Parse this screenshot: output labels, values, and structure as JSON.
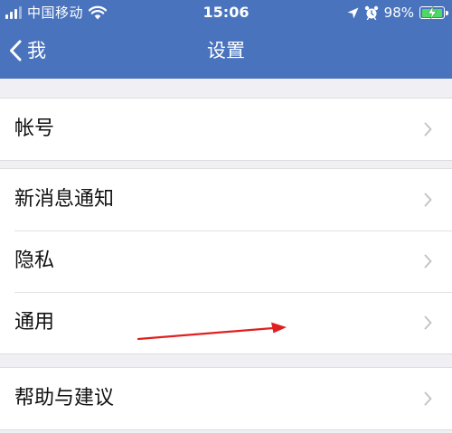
{
  "status_bar": {
    "carrier": "中国移动",
    "time": "15:06",
    "battery_percent": "98%",
    "icons": [
      "signal-icon",
      "wifi-icon",
      "location-arrow-icon",
      "alarm-clock-icon",
      "battery-charging-icon"
    ]
  },
  "nav": {
    "back_label": "我",
    "title": "设置"
  },
  "groups": [
    {
      "items": [
        {
          "label": "帐号"
        }
      ]
    },
    {
      "items": [
        {
          "label": "新消息通知"
        },
        {
          "label": "隐私"
        },
        {
          "label": "通用"
        }
      ]
    },
    {
      "items": [
        {
          "label": "帮助与建议"
        }
      ]
    }
  ],
  "colors": {
    "nav_background": "#4a73be",
    "page_background": "#efeff4",
    "battery_fill": "#4cd964",
    "annotation_arrow": "#e02020"
  }
}
